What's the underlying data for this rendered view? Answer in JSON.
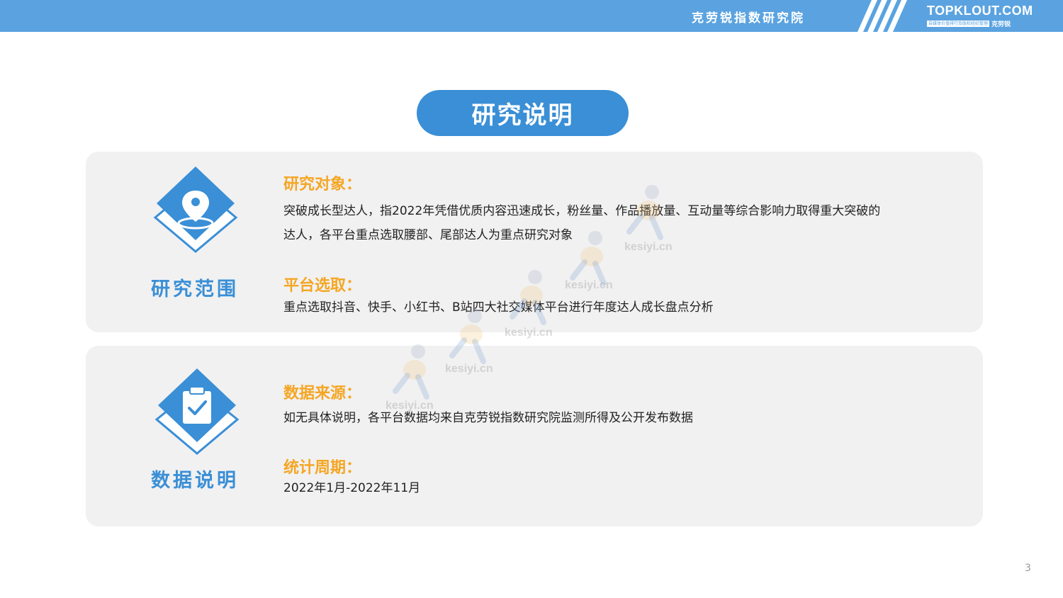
{
  "header": {
    "institute": "克劳锐指数研究院",
    "brand_title": "TOPKLOUT.COM",
    "brand_tagline": "自媒体价值排行及版权经纪管理",
    "brand_cn": "克劳锐"
  },
  "page_title": "研究说明",
  "sections": [
    {
      "icon": "location-pin-icon",
      "label": "研究范围",
      "items": [
        {
          "title": "研究对象：",
          "body_line1": "突破成长型达人，指2022年凭借优质内容迅速成长，粉丝量、作品播放量、互动量等综合影响力取得重大突破的",
          "body_line2": "达人，各平台重点选取腰部、尾部达人为重点研究对象"
        },
        {
          "title": "平台选取：",
          "body_line1": "重点选取抖音、快手、小红书、B站四大社交媒体平台进行年度达人成长盘点分析"
        }
      ]
    },
    {
      "icon": "clipboard-check-icon",
      "label": "数据说明",
      "items": [
        {
          "title": "数据来源：",
          "body_line1": "如无具体说明，各平台数据均来自克劳锐指数研究院监测所得及公开发布数据"
        },
        {
          "title": "统计周期：",
          "body_line1": "2022年1月-2022年11月"
        }
      ]
    }
  ],
  "watermark_text": "kesiyi.cn",
  "page_number": "3",
  "colors": {
    "header_bg": "#5aa3e0",
    "accent_blue": "#3a8fd6",
    "accent_orange": "#f5a623",
    "panel_bg": "#f1f1f2"
  }
}
